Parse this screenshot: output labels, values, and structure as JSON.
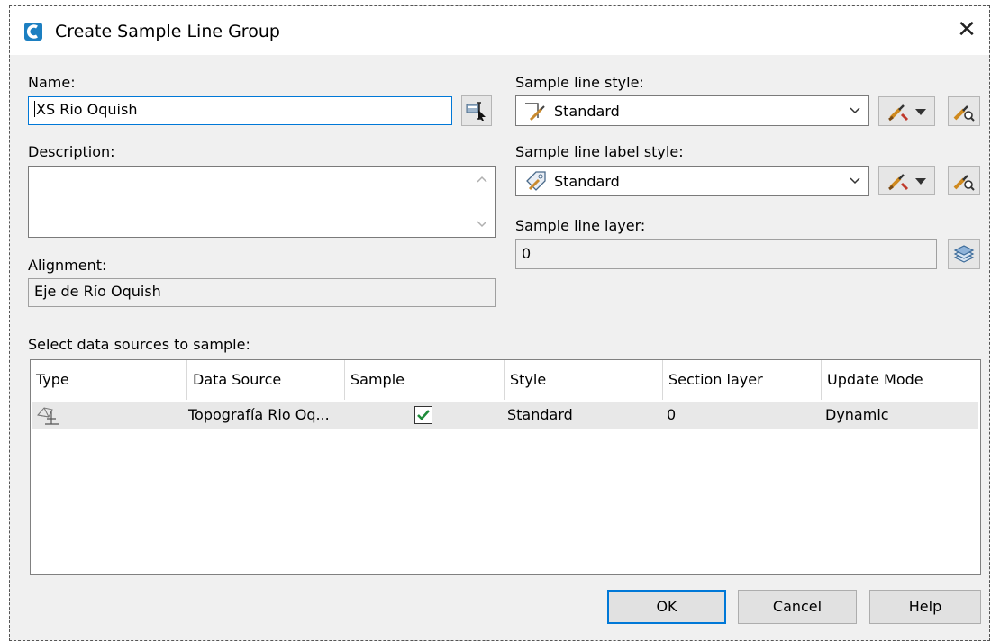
{
  "window": {
    "title": "Create Sample Line Group",
    "close": "✕"
  },
  "name": {
    "label": "Name:",
    "value": "XS Rio Oquish"
  },
  "description": {
    "label": "Description:",
    "value": ""
  },
  "alignment": {
    "label": "Alignment:",
    "value": "Eje de Río Oquish"
  },
  "sample_line_style": {
    "label": "Sample line style:",
    "value": "Standard"
  },
  "sample_line_label_style": {
    "label": "Sample line label style:",
    "value": "Standard"
  },
  "sample_line_layer": {
    "label": "Sample line layer:",
    "value": "0"
  },
  "data_sources": {
    "label": "Select data sources to sample:",
    "columns": [
      "Type",
      "Data Source",
      "Sample",
      "Style",
      "Section layer",
      "Update Mode"
    ],
    "rows": [
      {
        "type_icon": "surface-icon",
        "data_source": "Topografía Rio Oq...",
        "sample": true,
        "style": "Standard",
        "section_layer": "0",
        "update_mode": "Dynamic"
      }
    ]
  },
  "buttons": {
    "ok": "OK",
    "cancel": "Cancel",
    "help": "Help"
  },
  "colors": {
    "accent": "#0078d7",
    "check": "#1e8c3a",
    "app_icon": "#1c7fc1"
  }
}
